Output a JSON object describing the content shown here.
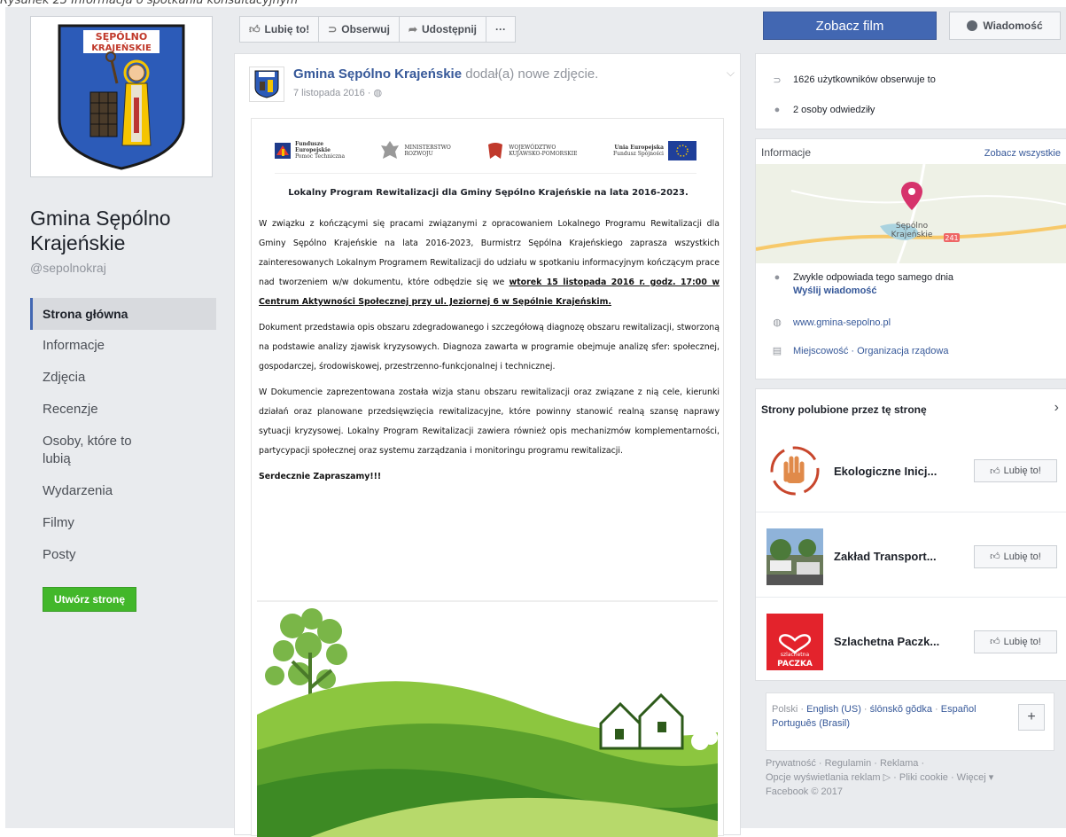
{
  "caption": "Rysunek 23 Informacja o spotkaniu konsultacyjnym",
  "page": {
    "badge_text_1": "SĘPÓLNO",
    "badge_text_2": "KRAJEŃSKIE",
    "name": "Gmina Sępólno Krajeńskie",
    "handle": "@sepolnokraj",
    "nav": [
      "Strona główna",
      "Informacje",
      "Zdjęcia",
      "Recenzje",
      "Osoby, które to lubią",
      "Wydarzenia",
      "Filmy",
      "Posty"
    ],
    "create_page": "Utwórz stronę"
  },
  "actions": {
    "like": "Lubię to!",
    "follow": "Obserwuj",
    "share": "Udostępnij",
    "more": "···",
    "watch": "Zobacz film",
    "message": "Wiadomość"
  },
  "post": {
    "author": "Gmina Sępólno Krajeńskie",
    "action": "dodał(a) nowe zdjęcie.",
    "date": "7 listopada 2016 · ",
    "logos": {
      "fe_1": "Fundusze",
      "fe_2": "Europejskie",
      "fe_3": "Pomoc Techniczna",
      "min_1": "MINISTERSTWO",
      "min_2": "ROZWOJU",
      "woj_1": "WOJEWÓDZTWO",
      "woj_2": "KUJAWSKO-POMORSKIE",
      "ue_1": "Unia Europejska",
      "ue_2": "Fundusz Spójności"
    },
    "doc_title": "Lokalny Program Rewitalizacji dla Gminy Sępólno Krajeńskie na lata 2016-2023.",
    "p1": "W związku z kończącymi się pracami związanymi z opracowaniem Lokalnego Programu Rewitalizacji dla Gminy Sępólno Krajeńskie na lata 2016-2023, Burmistrz Sępólna Krajeńskiego zaprasza wszystkich zainteresowanych Lokalnym Programem Rewitalizacji do udziału w spotkaniu informacyjnym kończącym prace nad tworzeniem w/w dokumentu, które odbędzie się we ",
    "p1_bold": "wtorek 15 listopada 2016 r. godz. 17:00 w Centrum Aktywności Społecznej przy ul. Jeziornej 6 w Sępólnie Krajeńskim.",
    "p2": "Dokument przedstawia opis obszaru zdegradowanego i szczegółową diagnozę obszaru rewitalizacji, stworzoną na podstawie analizy zjawisk kryzysowych. Diagnoza zawarta w programie obejmuje analizę sfer: społecznej, gospodarczej, środowiskowej, przestrzenno-funkcjonalnej i technicznej.",
    "p3": "W Dokumencie zaprezentowana została wizja stanu obszaru rewitalizacji oraz związane z nią cele, kierunki działań oraz planowane przedsięwzięcia rewitalizacyjne, które powinny stanowić realną szansę naprawy sytuacji kryzysowej. Lokalny Program Rewitalizacji zawiera również opis mechanizmów komplementarności, partycypacji społecznej oraz systemu zarządzania i monitoringu programu rewitalizacji.",
    "p4": "Serdecznie Zapraszamy!!!"
  },
  "about": {
    "followers": "1626 użytkowników obserwuje to",
    "visits": "2 osoby odwiedziły",
    "info_title": "Informacje",
    "see_all": "Zobacz wszystkie",
    "map_label_1": "Sępólno",
    "map_label_2": "Krajeńskie",
    "road": "241",
    "responds": "Zwykle odpowiada tego samego dnia",
    "send_message": "Wyślij wiadomość",
    "website": "www.gmina-sepolno.pl",
    "category": "Miejscowość · Organizacja rządowa"
  },
  "liked": {
    "title": "Strony polubione przez tę stronę",
    "pages": [
      "Ekologiczne Inicj...",
      "Zakład Transport...",
      "Szlachetna Paczk..."
    ],
    "like_label": "Lubię to!",
    "paczka_1": "szlachetna",
    "paczka_2": "PACZKA"
  },
  "footer": {
    "lang_current": "Polski · ",
    "lang_en": "English (US)",
    "sep": " · ",
    "lang_sl": "ślōnskŏ gŏdka",
    "lang_es": "Español",
    "lang_pt": "Português (Brasil)",
    "links_1": "Prywatność · Regulamin · Reklama ·",
    "links_2": "Opcje wyświetlania reklam ▷ · Pliki cookie · Więcej ▾",
    "links_3": "Facebook © 2017"
  },
  "colors": {
    "brand": "#4267b2",
    "green": "#42b72a",
    "link": "#365899"
  }
}
